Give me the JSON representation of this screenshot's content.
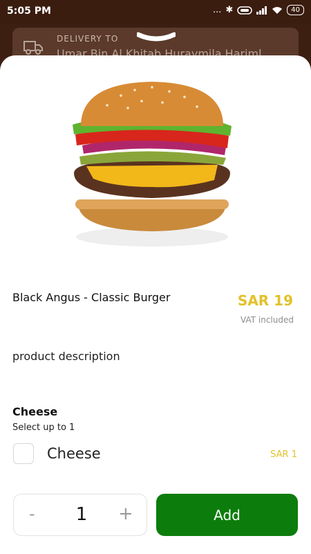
{
  "status_bar": {
    "time": "5:05 PM",
    "icons_text": "...",
    "battery": "40"
  },
  "delivery": {
    "label": "DELIVERY TO",
    "address": "Umar Bin Al Khitab Huraymila Hariml"
  },
  "product": {
    "image_icon": "burger-image",
    "name": "Black Angus - Classic Burger",
    "price": "SAR 19",
    "vat_note": "VAT included",
    "description": "product description"
  },
  "options": {
    "title": "Cheese",
    "subtitle": "Select up to 1",
    "items": [
      {
        "name": "Cheese",
        "price": "SAR 1",
        "checked": false
      }
    ]
  },
  "quantity": {
    "minus": "-",
    "value": "1",
    "plus": "+"
  },
  "add_button": {
    "label": "Add"
  },
  "colors": {
    "accent_green": "#0c7d0c",
    "price_yellow": "#e2c12a",
    "header_brown": "#3a1d0f"
  }
}
